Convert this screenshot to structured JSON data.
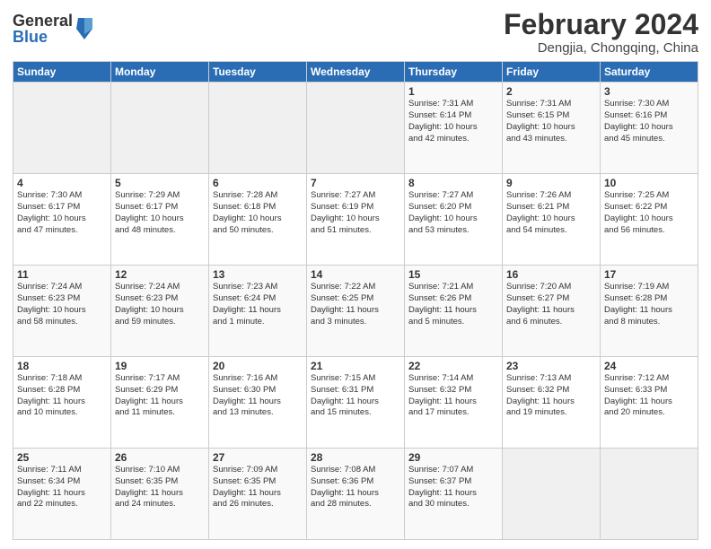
{
  "header": {
    "logo": {
      "general": "General",
      "blue": "Blue"
    },
    "title": "February 2024",
    "subtitle": "Dengjia, Chongqing, China"
  },
  "weekdays": [
    "Sunday",
    "Monday",
    "Tuesday",
    "Wednesday",
    "Thursday",
    "Friday",
    "Saturday"
  ],
  "weeks": [
    [
      {
        "day": "",
        "info": ""
      },
      {
        "day": "",
        "info": ""
      },
      {
        "day": "",
        "info": ""
      },
      {
        "day": "",
        "info": ""
      },
      {
        "day": "1",
        "info": "Sunrise: 7:31 AM\nSunset: 6:14 PM\nDaylight: 10 hours\nand 42 minutes."
      },
      {
        "day": "2",
        "info": "Sunrise: 7:31 AM\nSunset: 6:15 PM\nDaylight: 10 hours\nand 43 minutes."
      },
      {
        "day": "3",
        "info": "Sunrise: 7:30 AM\nSunset: 6:16 PM\nDaylight: 10 hours\nand 45 minutes."
      }
    ],
    [
      {
        "day": "4",
        "info": "Sunrise: 7:30 AM\nSunset: 6:17 PM\nDaylight: 10 hours\nand 47 minutes."
      },
      {
        "day": "5",
        "info": "Sunrise: 7:29 AM\nSunset: 6:17 PM\nDaylight: 10 hours\nand 48 minutes."
      },
      {
        "day": "6",
        "info": "Sunrise: 7:28 AM\nSunset: 6:18 PM\nDaylight: 10 hours\nand 50 minutes."
      },
      {
        "day": "7",
        "info": "Sunrise: 7:27 AM\nSunset: 6:19 PM\nDaylight: 10 hours\nand 51 minutes."
      },
      {
        "day": "8",
        "info": "Sunrise: 7:27 AM\nSunset: 6:20 PM\nDaylight: 10 hours\nand 53 minutes."
      },
      {
        "day": "9",
        "info": "Sunrise: 7:26 AM\nSunset: 6:21 PM\nDaylight: 10 hours\nand 54 minutes."
      },
      {
        "day": "10",
        "info": "Sunrise: 7:25 AM\nSunset: 6:22 PM\nDaylight: 10 hours\nand 56 minutes."
      }
    ],
    [
      {
        "day": "11",
        "info": "Sunrise: 7:24 AM\nSunset: 6:23 PM\nDaylight: 10 hours\nand 58 minutes."
      },
      {
        "day": "12",
        "info": "Sunrise: 7:24 AM\nSunset: 6:23 PM\nDaylight: 10 hours\nand 59 minutes."
      },
      {
        "day": "13",
        "info": "Sunrise: 7:23 AM\nSunset: 6:24 PM\nDaylight: 11 hours\nand 1 minute."
      },
      {
        "day": "14",
        "info": "Sunrise: 7:22 AM\nSunset: 6:25 PM\nDaylight: 11 hours\nand 3 minutes."
      },
      {
        "day": "15",
        "info": "Sunrise: 7:21 AM\nSunset: 6:26 PM\nDaylight: 11 hours\nand 5 minutes."
      },
      {
        "day": "16",
        "info": "Sunrise: 7:20 AM\nSunset: 6:27 PM\nDaylight: 11 hours\nand 6 minutes."
      },
      {
        "day": "17",
        "info": "Sunrise: 7:19 AM\nSunset: 6:28 PM\nDaylight: 11 hours\nand 8 minutes."
      }
    ],
    [
      {
        "day": "18",
        "info": "Sunrise: 7:18 AM\nSunset: 6:28 PM\nDaylight: 11 hours\nand 10 minutes."
      },
      {
        "day": "19",
        "info": "Sunrise: 7:17 AM\nSunset: 6:29 PM\nDaylight: 11 hours\nand 11 minutes."
      },
      {
        "day": "20",
        "info": "Sunrise: 7:16 AM\nSunset: 6:30 PM\nDaylight: 11 hours\nand 13 minutes."
      },
      {
        "day": "21",
        "info": "Sunrise: 7:15 AM\nSunset: 6:31 PM\nDaylight: 11 hours\nand 15 minutes."
      },
      {
        "day": "22",
        "info": "Sunrise: 7:14 AM\nSunset: 6:32 PM\nDaylight: 11 hours\nand 17 minutes."
      },
      {
        "day": "23",
        "info": "Sunrise: 7:13 AM\nSunset: 6:32 PM\nDaylight: 11 hours\nand 19 minutes."
      },
      {
        "day": "24",
        "info": "Sunrise: 7:12 AM\nSunset: 6:33 PM\nDaylight: 11 hours\nand 20 minutes."
      }
    ],
    [
      {
        "day": "25",
        "info": "Sunrise: 7:11 AM\nSunset: 6:34 PM\nDaylight: 11 hours\nand 22 minutes."
      },
      {
        "day": "26",
        "info": "Sunrise: 7:10 AM\nSunset: 6:35 PM\nDaylight: 11 hours\nand 24 minutes."
      },
      {
        "day": "27",
        "info": "Sunrise: 7:09 AM\nSunset: 6:35 PM\nDaylight: 11 hours\nand 26 minutes."
      },
      {
        "day": "28",
        "info": "Sunrise: 7:08 AM\nSunset: 6:36 PM\nDaylight: 11 hours\nand 28 minutes."
      },
      {
        "day": "29",
        "info": "Sunrise: 7:07 AM\nSunset: 6:37 PM\nDaylight: 11 hours\nand 30 minutes."
      },
      {
        "day": "",
        "info": ""
      },
      {
        "day": "",
        "info": ""
      }
    ]
  ]
}
